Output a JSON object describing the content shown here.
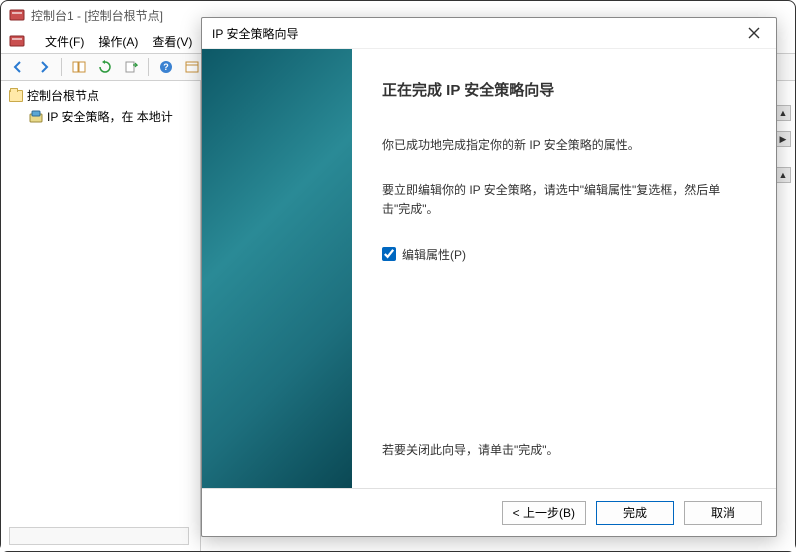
{
  "window": {
    "title": "控制台1 - [控制台根节点]"
  },
  "menubar": {
    "file": "文件(F)",
    "action": "操作(A)",
    "view": "查看(V)"
  },
  "tree": {
    "root": "控制台根节点",
    "child": "IP 安全策略，在 本地计"
  },
  "dialog": {
    "title": "IP 安全策略向导",
    "heading": "正在完成 IP 安全策略向导",
    "line1": "你已成功地完成指定你的新 IP 安全策略的属性。",
    "line2": "要立即编辑你的 IP 安全策略，请选中\"编辑属性\"复选框，然后单击\"完成\"。",
    "checkbox_label": "编辑属性(P)",
    "footer_hint": "若要关闭此向导，请单击\"完成\"。",
    "btn_back": "< 上一步(B)",
    "btn_finish": "完成",
    "btn_cancel": "取消"
  }
}
